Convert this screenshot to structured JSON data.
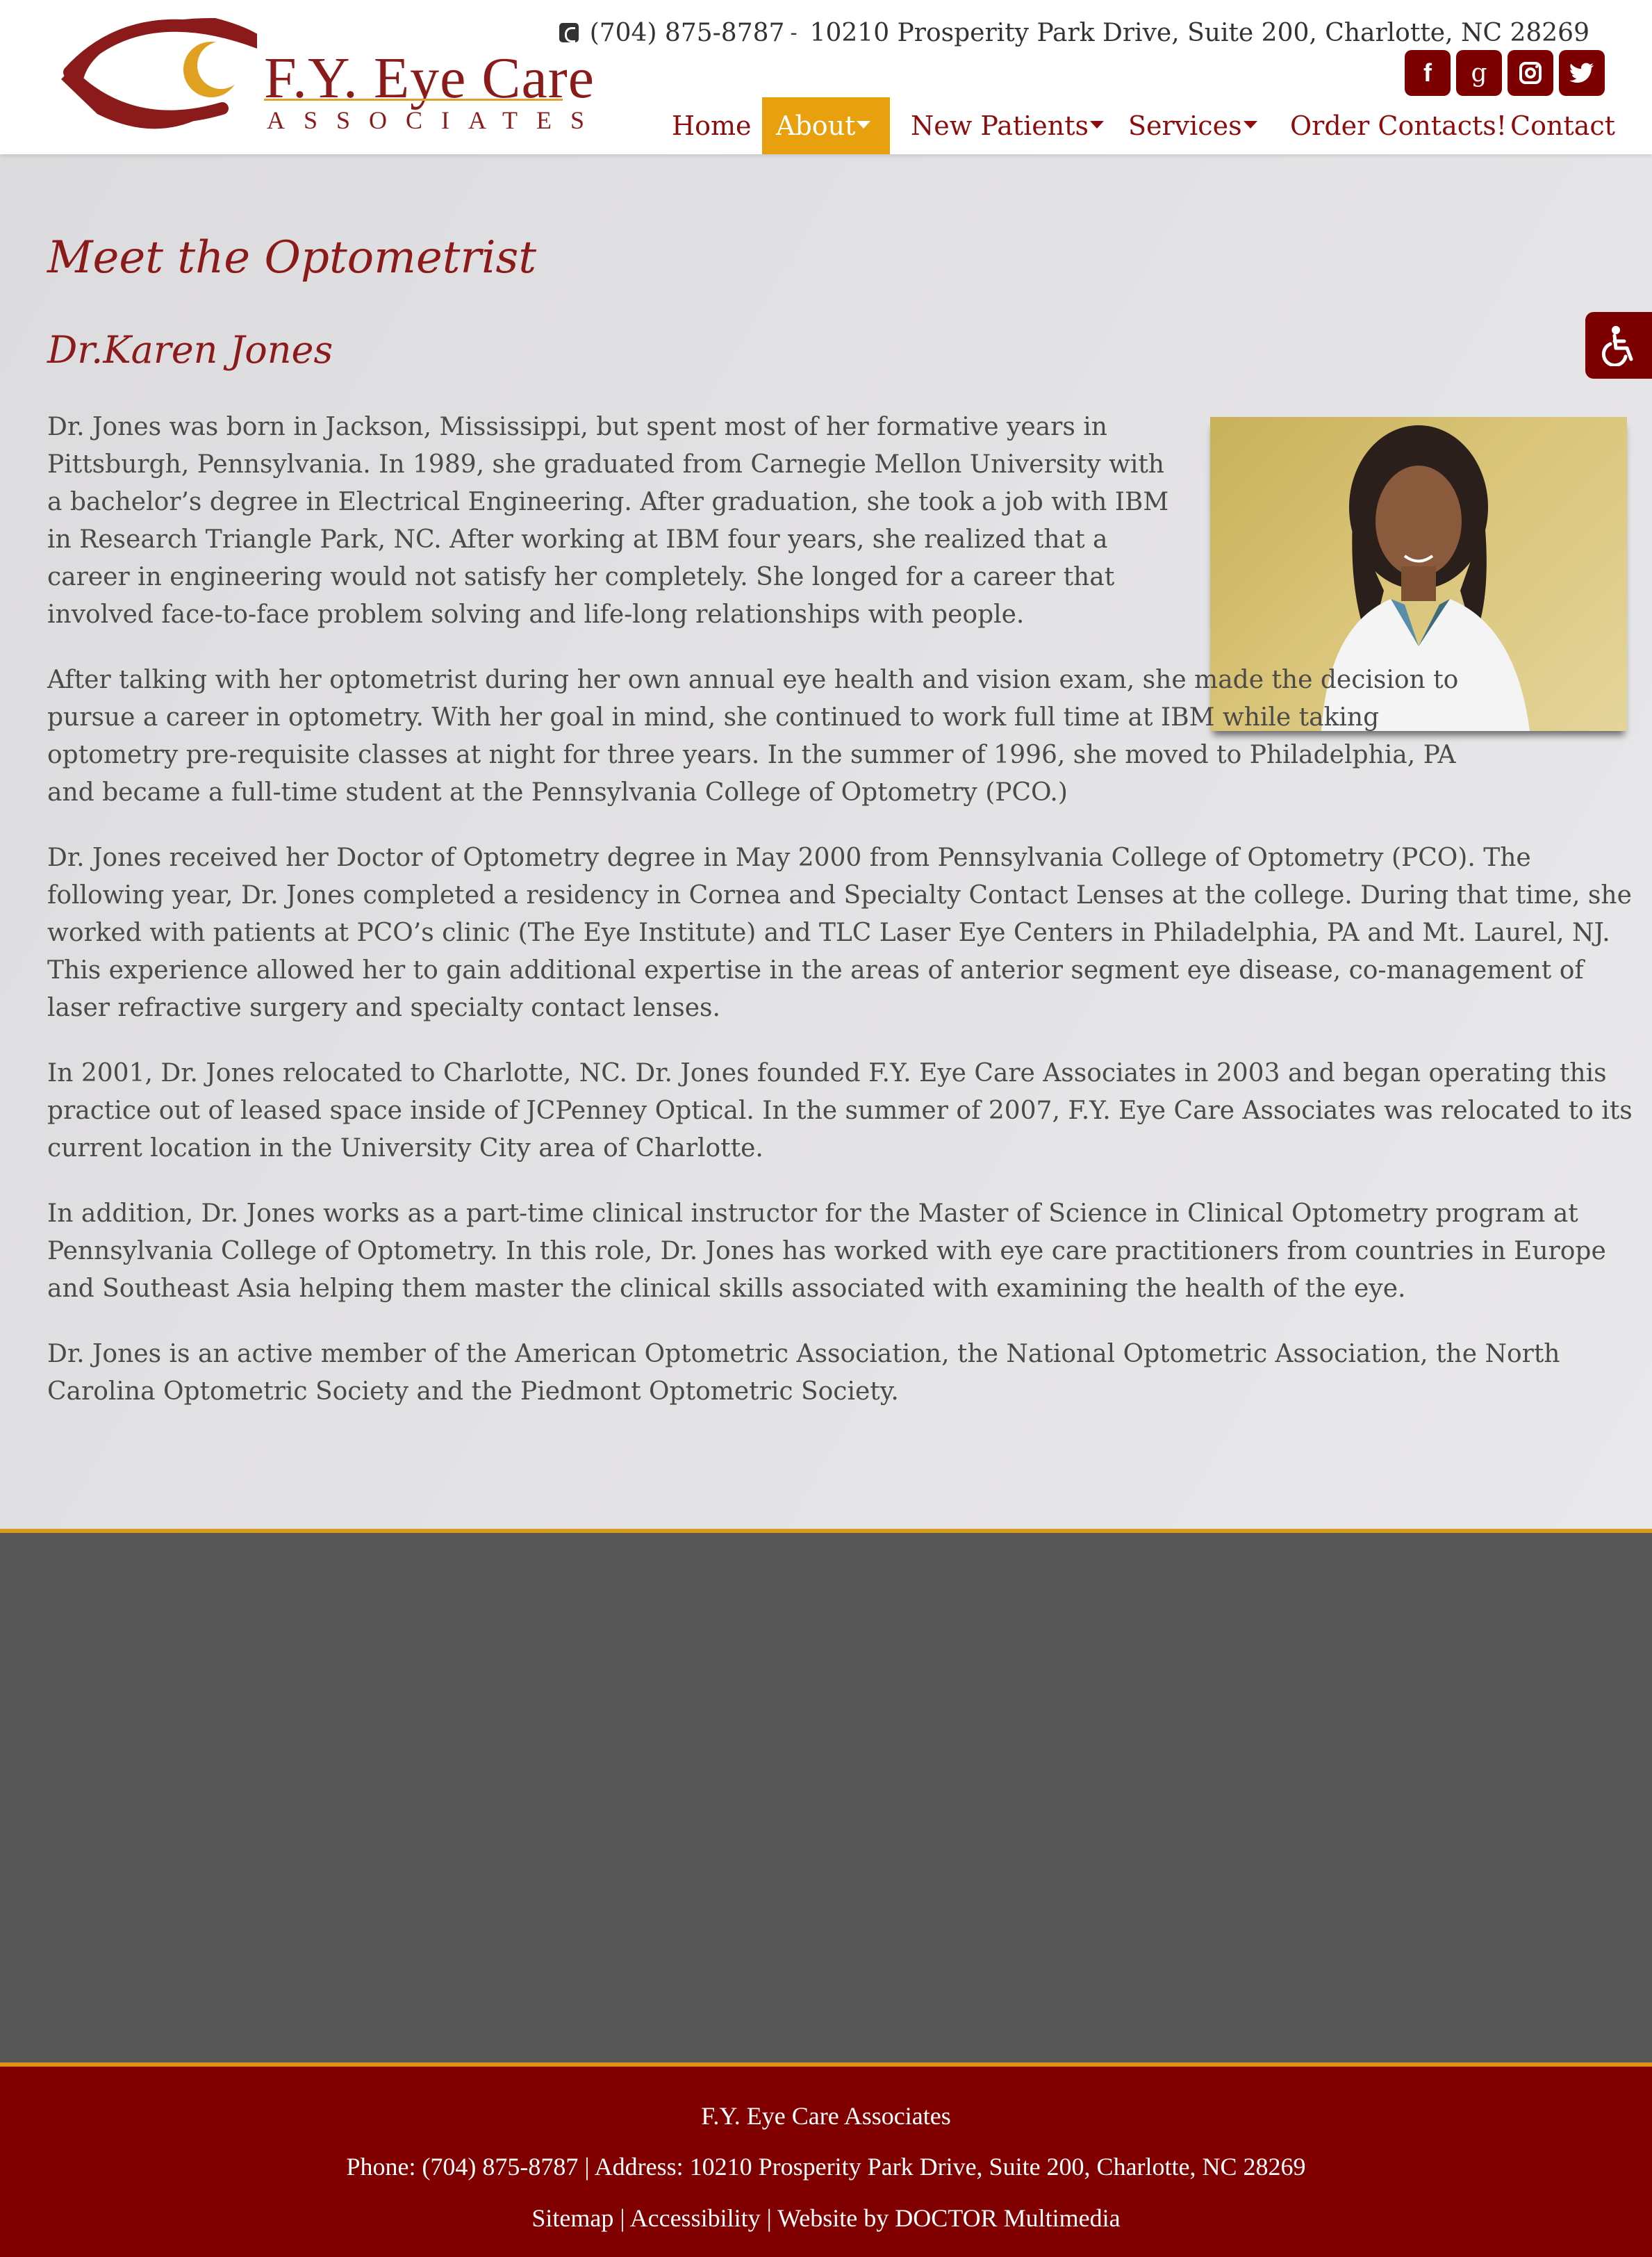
{
  "header": {
    "logo": {
      "line1": "F.Y. Eye Care",
      "line2": "ASSOCIATES"
    },
    "phone": "(704) 875-8787",
    "separator": "-",
    "address": "10210 Prosperity Park Drive, Suite 200, Charlotte, NC 28269",
    "social": [
      {
        "icon": "facebook-icon",
        "glyph": "f"
      },
      {
        "icon": "google-plus-icon",
        "glyph": "g"
      },
      {
        "icon": "instagram-icon",
        "glyph": "◎"
      },
      {
        "icon": "twitter-icon",
        "glyph": "🐦"
      }
    ]
  },
  "nav": {
    "items": [
      {
        "label": "Home",
        "dropdown": false,
        "active": false
      },
      {
        "label": "About",
        "dropdown": true,
        "active": true
      },
      {
        "label": "New Patients",
        "dropdown": true,
        "active": false
      },
      {
        "label": "Services",
        "dropdown": true,
        "active": false
      },
      {
        "label": "Order Contacts!",
        "dropdown": false,
        "active": false
      },
      {
        "label": "Contact",
        "dropdown": false,
        "active": false
      }
    ],
    "active_color": "#e8a00e"
  },
  "main": {
    "title": "Meet the Optometrist",
    "subtitle": "Dr.Karen Jones",
    "paragraphs": [
      "Dr. Jones was born in Jackson, Mississippi, but spent most of her formative years in Pittsburgh, Pennsylvania. In 1989, she graduated from Carnegie Mellon University with a bachelor’s degree in Electrical Engineering. After graduation, she took a job with IBM in Research Triangle Park, NC. After working at IBM four years, she realized that a career in engineering would not satisfy her completely. She longed for a career that involved face-to-face problem solving and life-long relationships with people.",
      "After talking with her optometrist during her own annual eye health and vision exam, she made the decision to pursue a career in optometry. With her goal in mind, she continued to work full time at IBM while taking optometry pre-requisite classes at night for three years. In the summer of 1996, she moved to Philadelphia, PA and became a full-time student at the Pennsylvania College of Optometry (PCO.)",
      "Dr. Jones received her Doctor of Optometry degree in May 2000 from Pennsylvania College of Optometry (PCO). The following year, Dr. Jones completed a residency in Cornea and Specialty Contact Lenses at the college. During that time, she worked with patients at PCO’s clinic (The Eye Institute) and TLC Laser Eye Centers in Philadelphia, PA and Mt. Laurel, NJ. This experience allowed her to gain additional expertise in the areas of anterior segment eye disease, co-management of laser refractive surgery and specialty contact lenses.",
      "In 2001, Dr. Jones relocated to Charlotte, NC. Dr. Jones founded F.Y. Eye Care Associates in 2003 and began operating this practice out of leased space inside of JCPenney Optical. In the summer of 2007, F.Y. Eye Care Associates was relocated to its current location in the University City area of Charlotte.",
      "In addition, Dr. Jones works as a part-time clinical instructor for the Master of Science in Clinical Optometry program at Pennsylvania College of Optometry. In this role, Dr. Jones has worked with eye care practitioners from countries in Europe and Southeast Asia helping them master the clinical skills associated with examining the health of the eye.",
      "Dr. Jones is an active member of the American Optometric Association, the National Optometric Association, the North Carolina Optometric Society and the Piedmont Optometric Society."
    ],
    "photo": "portrait-photo"
  },
  "accessibility_button": {
    "icon": "wheelchair-icon"
  },
  "footer": {
    "name": "F.Y. Eye Care Associates",
    "contact": "Phone: (704) 875-8787  |  Address: 10210 Prosperity Park Drive, Suite 200, Charlotte, NC 28269",
    "sitemap": "Sitemap",
    "accessibility": "Accessibility",
    "credit": "Website by DOCTOR Multimedia",
    "divider": "|"
  },
  "colors": {
    "brand": "#800000",
    "accent": "#e8a00e",
    "band": "#575757"
  }
}
